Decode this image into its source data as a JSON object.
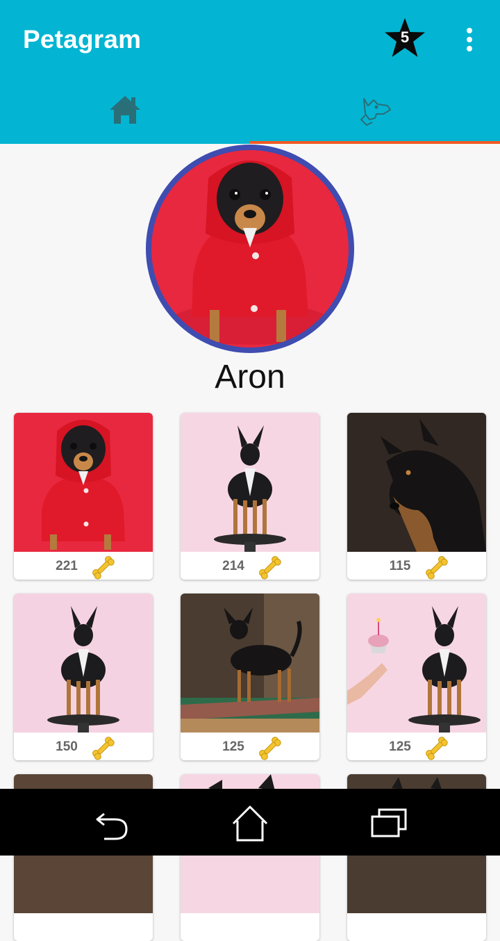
{
  "app": {
    "title": "Petagram",
    "favorites_count": "5"
  },
  "tabs": [
    {
      "name": "home",
      "icon": "home-icon",
      "selected": false
    },
    {
      "name": "profile",
      "icon": "dog-icon",
      "selected": true
    }
  ],
  "profile": {
    "name": "Aron"
  },
  "grid": {
    "items": [
      {
        "likes": "221",
        "icon": "bone-icon"
      },
      {
        "likes": "214",
        "icon": "bone-icon"
      },
      {
        "likes": "115",
        "icon": "bone-icon"
      },
      {
        "likes": "150",
        "icon": "bone-icon"
      },
      {
        "likes": "125",
        "icon": "bone-icon"
      },
      {
        "likes": "125",
        "icon": "bone-icon"
      }
    ]
  },
  "colors": {
    "primary": "#03b5d2",
    "accent": "#f15a24",
    "avatar_ring": "#3f4cb0",
    "bone": "#f4c430"
  },
  "navigation": [
    "back-icon",
    "home-icon",
    "recents-icon"
  ]
}
